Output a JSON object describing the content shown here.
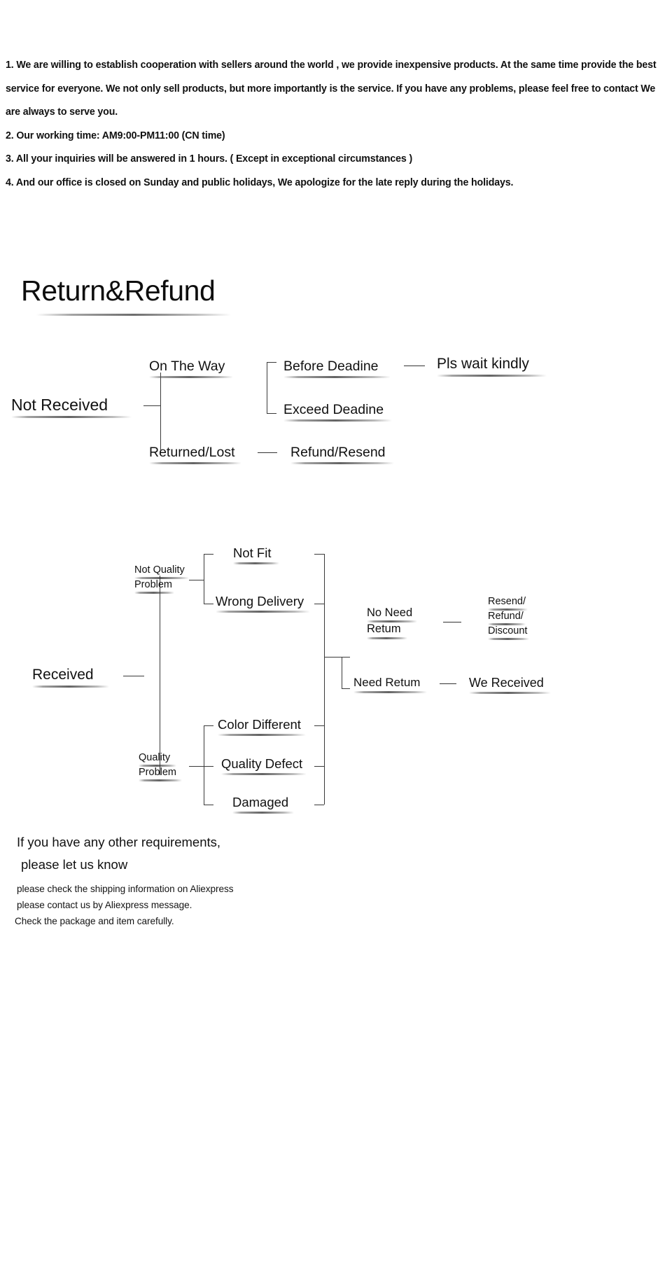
{
  "policy": {
    "lines": [
      "1. We are willing to establish cooperation with sellers around the world , we provide inexpensive products. At the same time provide the best",
      "service for everyone. We not only sell products, but more importantly is the service. If you have any problems, please feel free to contact We",
      "are always to serve you.",
      "2. Our working time: AM9:00-PM11:00 (CN time)",
      "3. All your inquiries will be answered in 1 hours. ( Except in exceptional circumstances )",
      "4. And our office is closed on Sunday and public holidays, We apologize for the late reply during the holidays."
    ]
  },
  "heading": {
    "title": "Return&Refund"
  },
  "flow_not_received": {
    "root": "Not   Received",
    "on_the_way": "On The Way",
    "before_deadline": "Before Deadine",
    "exceed_deadline": "Exceed Deadine",
    "pls_wait": "Pls wait kindly",
    "returned_lost": "Returned/Lost",
    "refund_resend": "Refund/Resend"
  },
  "flow_received": {
    "root": "Received",
    "not_quality_problem_l1": "Not Quality",
    "not_quality_problem_l2": "Problem",
    "quality_problem_l1": "Quality",
    "quality_problem_l2": "Problem",
    "not_fit": "Not Fit",
    "wrong_delivery": "Wrong Delivery",
    "color_different": "Color Different",
    "quality_defect": "Quality Defect",
    "damaged": "Damaged",
    "no_need_return_l1": "No Need",
    "no_need_return_l2": "Retum",
    "need_return": "Need Retum",
    "resend_l1": "Resend/",
    "resend_l2": "Refund/",
    "resend_l3": "Discount",
    "we_received": "We Received"
  },
  "closing": {
    "big_line_1": "If you have any other requirements,",
    "big_line_2": "please let us know",
    "small_line_1": "please check the shipping information on Aliexpress",
    "small_line_2": "please contact us by Aliexpress message.",
    "small_line_3": "Check the package and item carefully."
  }
}
